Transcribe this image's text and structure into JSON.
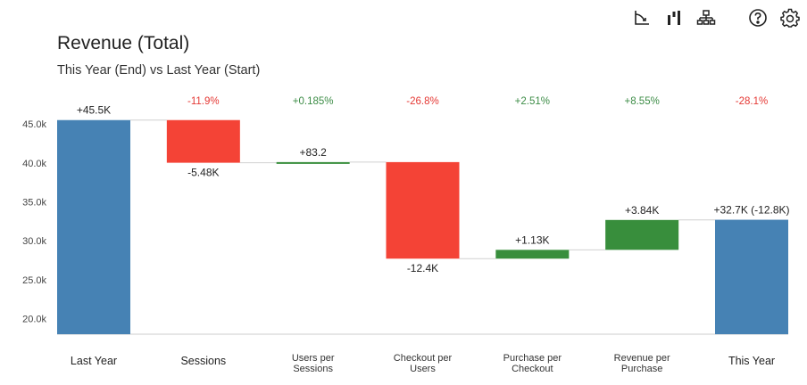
{
  "header": {
    "title": "Revenue (Total)",
    "subtitle": "This Year (End) vs Last Year (Start)"
  },
  "toolbar": {
    "icons": [
      "chart-axis-icon",
      "column-bars-icon",
      "hierarchy-icon",
      "help-icon",
      "settings-icon"
    ]
  },
  "colors": {
    "total": "#4682b4",
    "increase": "#388e3c",
    "decrease": "#f44336",
    "positive_text": "#3c8c46",
    "negative_text": "#e53935"
  },
  "chart_data": {
    "type": "waterfall",
    "ylim": [
      18000,
      46500
    ],
    "yticks": [
      20000,
      25000,
      30000,
      35000,
      40000,
      45000
    ],
    "ytick_labels": [
      "20.0k",
      "25.0k",
      "30.0k",
      "35.0k",
      "40.0k",
      "45.0k"
    ],
    "categories": [
      "Last Year",
      "Sessions",
      "Users per|Sessions",
      "Checkout per|Users",
      "Purchase per|Checkout",
      "Revenue per|Purchase",
      "This Year"
    ],
    "steps": [
      {
        "kind": "total",
        "start": 0,
        "end": 45500,
        "label": "+45.5K",
        "pct": ""
      },
      {
        "kind": "delta",
        "start": 45500,
        "end": 40020,
        "label": "-5.48K",
        "pct": "-11.9%"
      },
      {
        "kind": "delta",
        "start": 40020,
        "end": 40103,
        "label": "+83.2",
        "pct": "+0.185%"
      },
      {
        "kind": "delta",
        "start": 40103,
        "end": 27703,
        "label": "-12.4K",
        "pct": "-26.8%"
      },
      {
        "kind": "delta",
        "start": 27703,
        "end": 28833,
        "label": "+1.13K",
        "pct": "+2.51%"
      },
      {
        "kind": "delta",
        "start": 28833,
        "end": 32673,
        "label": "+3.84K",
        "pct": "+8.55%"
      },
      {
        "kind": "total",
        "start": 0,
        "end": 32700,
        "label": "+32.7K (-12.8K)",
        "pct": "-28.1%"
      }
    ]
  }
}
